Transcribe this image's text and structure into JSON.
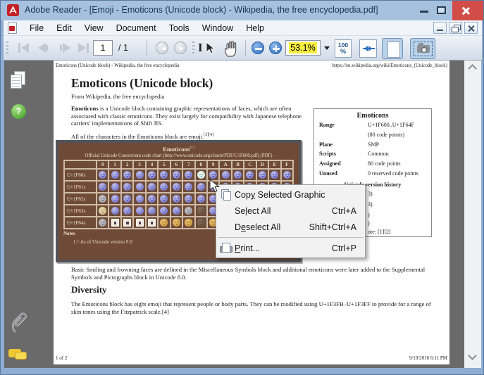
{
  "window": {
    "title": "Adobe Reader - [Emoji - Emoticons (Unicode block) - Wikipedia, the free encyclopedia.pdf]"
  },
  "menubar": {
    "items": [
      "File",
      "Edit",
      "View",
      "Document",
      "Tools",
      "Window",
      "Help"
    ]
  },
  "toolbar": {
    "page_current": "1",
    "page_total": "/ 1",
    "zoom_value": "53.1%",
    "zoom100_top": "100",
    "zoom100_bottom": "%"
  },
  "page": {
    "header_left": "Emoticons (Unicode block) - Wikipedia, the free encyclopedia",
    "header_right": "https://en.wikipedia.org/wiki/Emoticons_(Unicode_block)",
    "title": "Emoticons (Unicode block)",
    "subtitle": "From Wikipedia, the free encyclopedia",
    "para1_lines": [
      {
        "bold": "Emoticons",
        "text": " is a Unicode block containing graphic representations of faces, which are often"
      },
      {
        "text": "associated with classic emoticons. They exist largely for compatibility with Japanese telephone"
      },
      {
        "text": "carriers' implementations of Shift JIS."
      }
    ],
    "para2_text": "All of the characters in the Emoticons block are emoji.",
    "para2_refs": "[3][4]",
    "para3_lines": [
      {
        "text": "Basic Smiling and frowning faces are defined in the Miscellaneous Symbols block and additional emoticons were later added to the Supplemental"
      },
      {
        "text": "Symbols and Pictographs block in Unicode 8.0."
      }
    ],
    "heading_diversity": "Diversity",
    "para4_lines": [
      {
        "text": "The Emoticons block has eight emoji that represent people or body parts. They can be modified using U+1F3FB–U+1F3FF to provide for a range of"
      },
      {
        "text": "skin tones using the Fitzpatrick scale.[4]"
      }
    ],
    "footer_left": "1 of 2",
    "footer_right": "9/19/2016 6:11 PM"
  },
  "infobox": {
    "title": "Emoticons",
    "rows": [
      {
        "label": "Range",
        "value": "U+1F600..U+1F64F"
      },
      {
        "label": "",
        "value": "(80 code points)"
      },
      {
        "label": "Plane",
        "value": "SMP"
      },
      {
        "label": "Scripts",
        "value": "Common"
      },
      {
        "label": "Assigned",
        "value": "80 code points"
      },
      {
        "label": "Unused",
        "value": "0 reserved code points"
      }
    ],
    "history_header": "Unicode version history",
    "history_fragments": [
      "3)",
      "3)",
      ")",
      ")",
      "ote: [1][2]"
    ]
  },
  "emoji_table": {
    "caption_title": "Emoticons",
    "caption_ref": "[1]",
    "caption_sub": "Official Unicode Consortium code chart (http://www.unicode.org/charts/PDF/U1F600.pdf) (PDF)",
    "col_headers": [
      "0",
      "1",
      "2",
      "3",
      "4",
      "5",
      "6",
      "7",
      "8",
      "9",
      "A",
      "B",
      "C",
      "D",
      "E",
      "F"
    ],
    "rows": [
      {
        "label": "U+1F60x",
        "cells": [
          "p",
          "p",
          "p",
          "p",
          "p",
          "p",
          "p",
          "p",
          "c",
          "p",
          "p",
          "p",
          "p",
          "p",
          "p",
          "p"
        ]
      },
      {
        "label": "U+1F61x",
        "cells": [
          "p",
          "p",
          "p",
          "p",
          "p",
          "p",
          "p",
          "p",
          "p",
          "p",
          "p",
          "p",
          "p",
          "p",
          "p",
          "p"
        ]
      },
      {
        "label": "U+1F62x",
        "cells": [
          "m",
          "p",
          "p",
          "p",
          "p",
          "p",
          "p",
          "p",
          "p",
          "p",
          "p",
          "p",
          "p",
          "p",
          "p",
          "p"
        ]
      },
      {
        "label": "U+1F63x",
        "cells": [
          "t",
          "p",
          "p",
          "p",
          "p",
          "p",
          "p",
          "m",
          "d",
          "p",
          "p",
          "p",
          "p",
          "p",
          "p",
          "p"
        ]
      },
      {
        "label": "U+1F64x",
        "cells": [
          "m",
          "x",
          "x",
          "x",
          "x",
          "g",
          "g",
          "g",
          "d",
          "g",
          "g",
          "g",
          "g",
          "g",
          "g",
          "g"
        ]
      }
    ],
    "notes_label": "Notes",
    "note1": "1.^ As of Unicode version 9.0"
  },
  "context_menu": {
    "items": [
      {
        "pre": "Cop",
        "mn": "y",
        "post": " Selected Graphic",
        "shortcut": "",
        "icon": "copy"
      },
      {
        "pre": "Se",
        "mn": "l",
        "post": "ect All",
        "shortcut": "Ctrl+A"
      },
      {
        "pre": "D",
        "mn": "e",
        "post": "select All",
        "shortcut": "Shift+Ctrl+A"
      },
      {
        "separator": true
      },
      {
        "pre": "",
        "mn": "P",
        "post": "rint...",
        "shortcut": "Ctrl+P",
        "icon": "print"
      }
    ]
  }
}
